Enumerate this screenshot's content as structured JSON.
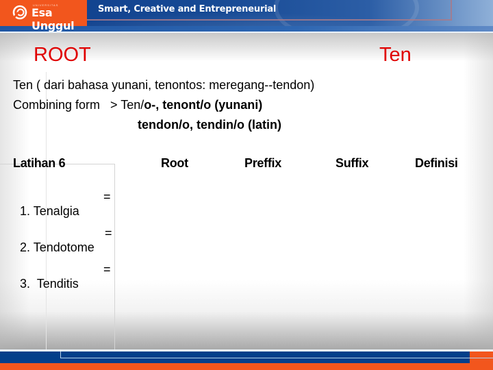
{
  "header": {
    "logo": {
      "small_text": "UNIVERSITAS",
      "name": "Esa Unggul",
      "icon": "esa-unggul-logo-icon"
    },
    "tagline": "Smart, Creative and Entrepreneurial",
    "colors": {
      "brand_orange": "#f2561d",
      "brand_blue": "#033f8a"
    }
  },
  "slide": {
    "title_left": "ROOT",
    "title_right": "Ten",
    "title_color": "#e00000",
    "definition_line": "Ten ( dari bahasa yunani, tenontos: meregang--tendon)",
    "combining": {
      "label": "Combining form   > ",
      "regular_part": "Ten/",
      "bold_part": "o-, tenont/o (yunani)",
      "second_line": "tendon/o, tendin/o (latin)"
    },
    "exercise": {
      "headers": [
        "Latihan 6",
        "Root",
        "Preffix",
        "Suffix",
        "Definisi"
      ],
      "items": [
        {
          "term": "1. Tenalgia",
          "equals": "="
        },
        {
          "term": "2. Tendotome",
          "equals": "="
        },
        {
          "term": "3.  Tenditis",
          "equals": "="
        }
      ]
    }
  }
}
